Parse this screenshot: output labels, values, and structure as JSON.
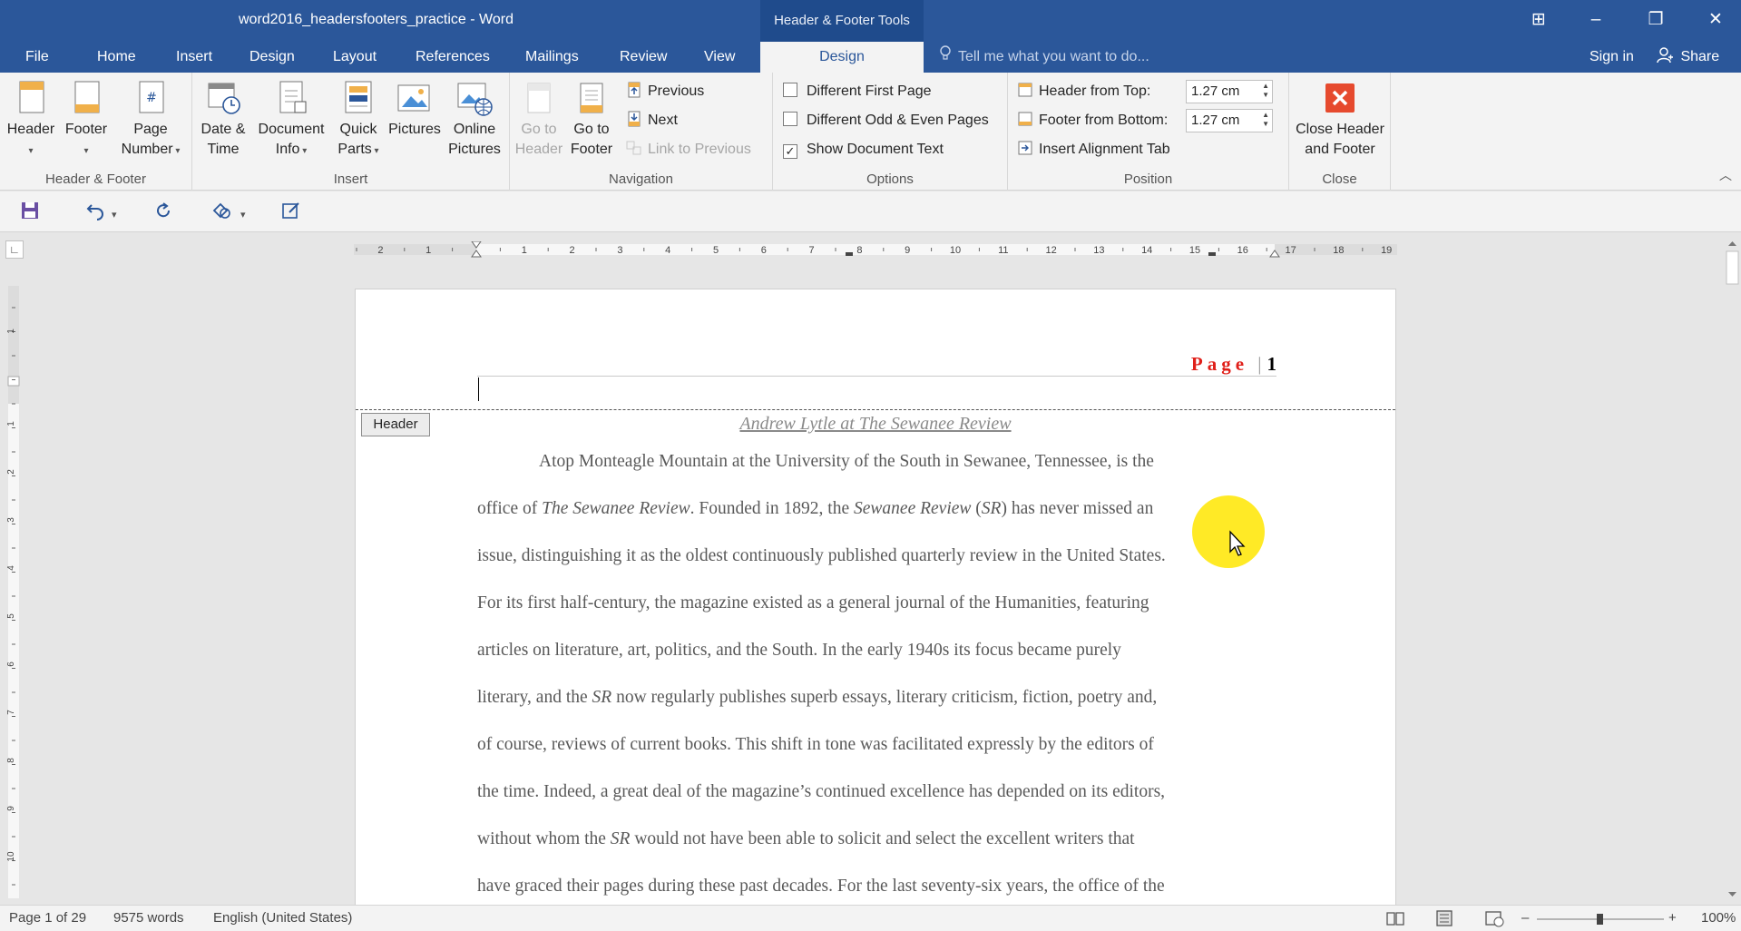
{
  "window": {
    "title": "word2016_headersfooters_practice - Word",
    "context_title": "Header & Footer Tools",
    "controls": {
      "ribbon_options": "⊞",
      "minimize": "–",
      "restore": "❐",
      "close": "✕"
    }
  },
  "tabs": {
    "file": "File",
    "home": "Home",
    "insert": "Insert",
    "design": "Design",
    "layout": "Layout",
    "references": "References",
    "mailings": "Mailings",
    "review": "Review",
    "view": "View",
    "hf_design": "Design"
  },
  "tellme": {
    "placeholder": "Tell me what you want to do..."
  },
  "account": {
    "signin": "Sign in",
    "share": "Share"
  },
  "ribbon": {
    "groups": {
      "header_footer": "Header & Footer",
      "insert": "Insert",
      "navigation": "Navigation",
      "options": "Options",
      "position": "Position",
      "close": "Close"
    },
    "header_btn": "Header",
    "footer_btn": "Footer",
    "page_number": [
      "Page",
      "Number"
    ],
    "date_time": [
      "Date &",
      "Time"
    ],
    "document_info": [
      "Document",
      "Info"
    ],
    "quick_parts": [
      "Quick",
      "Parts"
    ],
    "pictures": "Pictures",
    "online_pictures": [
      "Online",
      "Pictures"
    ],
    "go_to_header": [
      "Go to",
      "Header"
    ],
    "go_to_footer": [
      "Go to",
      "Footer"
    ],
    "previous": "Previous",
    "next": "Next",
    "link_to_previous": "Link to Previous",
    "options": {
      "different_first_page": "Different First Page",
      "different_odd_even": "Different Odd & Even Pages",
      "show_document_text": "Show Document Text",
      "different_first_page_checked": false,
      "different_odd_even_checked": false,
      "show_document_text_checked": true
    },
    "position": {
      "header_from_top_label": "Header from Top:",
      "header_from_top_value": "1.27 cm",
      "footer_from_bottom_label": "Footer from Bottom:",
      "footer_from_bottom_value": "1.27 cm",
      "insert_alignment_tab": "Insert Alignment Tab"
    },
    "close_header_footer": [
      "Close Header",
      "and Footer"
    ]
  },
  "ruler": {
    "horizontal_left_numbers": [
      "2",
      "1"
    ],
    "horizontal_numbers": [
      "1",
      "2",
      "3",
      "4",
      "5",
      "6",
      "7",
      "8",
      "9",
      "10",
      "11",
      "12",
      "13",
      "14",
      "15",
      "16",
      "17",
      "18",
      "19"
    ],
    "vertical_numbers": [
      "1",
      "1",
      "2",
      "3",
      "4",
      "5",
      "6",
      "7",
      "8",
      "9",
      "10"
    ]
  },
  "document": {
    "header_page_word": "Page",
    "header_separator": "|",
    "header_page_num": "1",
    "header_tag": "Header",
    "title": "Andrew Lytle at The Sewanee Review",
    "lines": [
      "Atop Monteagle Mountain at the University of the South in Sewanee, Tennessee, is the",
      "office of |The Sewanee Review|. Founded in 1892, the |Sewanee Review| (|SR|) has never missed an",
      "issue, distinguishing it as the oldest continuously published quarterly review in the United States.",
      "For its first half-century, the magazine existed as a general journal of the Humanities, featuring",
      "articles on literature, art, politics, and the South. In the early 1940s its focus became purely",
      "literary, and the |SR| now regularly publishes superb essays, literary criticism, fiction, poetry and,",
      "of course, reviews of current books. This shift in tone was facilitated expressly by the editors of",
      "the time. Indeed, a great deal of the magazine’s continued excellence has depended on its editors,",
      "without whom the |SR| would not have been able to solicit and select the excellent writers that",
      "have graced their pages during these past decades. For the last seventy-six years, the office of the"
    ]
  },
  "status": {
    "page": "Page 1 of 29",
    "words": "9575 words",
    "language": "English (United States)",
    "zoom_minus": "–",
    "zoom_plus": "+",
    "zoom": "100%"
  },
  "colors": {
    "title_bar": "#2b579a",
    "ribbon": "#f3f3f3",
    "accent_red": "#e0201a",
    "close_button": "#e64a2e"
  }
}
